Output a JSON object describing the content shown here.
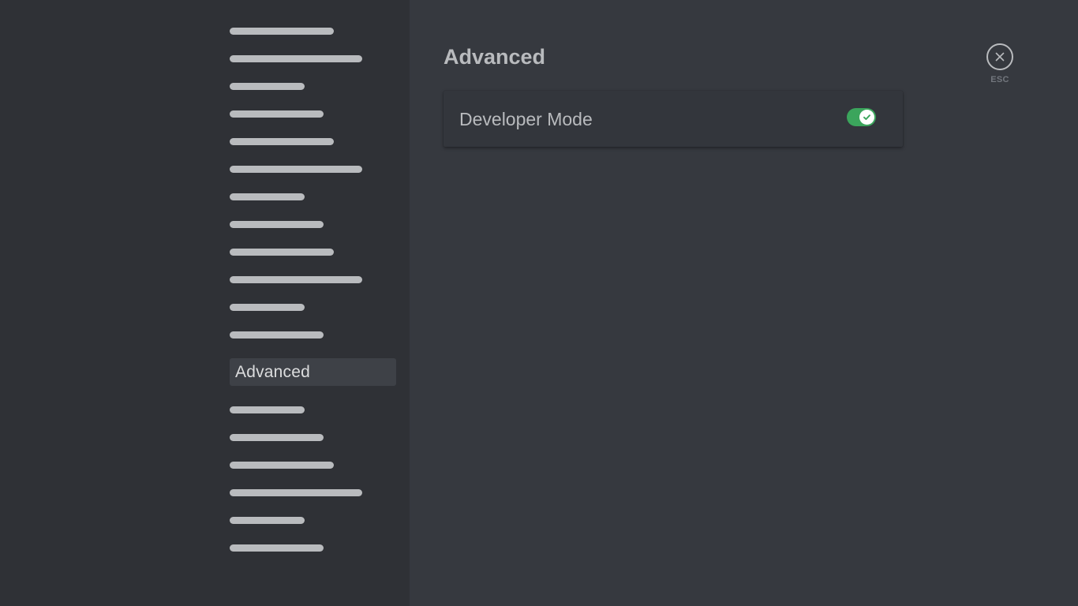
{
  "sidebar": {
    "selected_label": "Advanced"
  },
  "page": {
    "title": "Advanced"
  },
  "settings": {
    "developer_mode": {
      "label": "Developer Mode",
      "enabled": true
    }
  },
  "close": {
    "esc_label": "ESC"
  },
  "colors": {
    "sidebar_bg": "#2f3136",
    "main_bg": "#36393f",
    "toggle_on": "#3ba55c",
    "placeholder_bar": "#b9bbbe"
  },
  "icons": {
    "toggle_knob": "check-icon",
    "close": "close-icon"
  }
}
